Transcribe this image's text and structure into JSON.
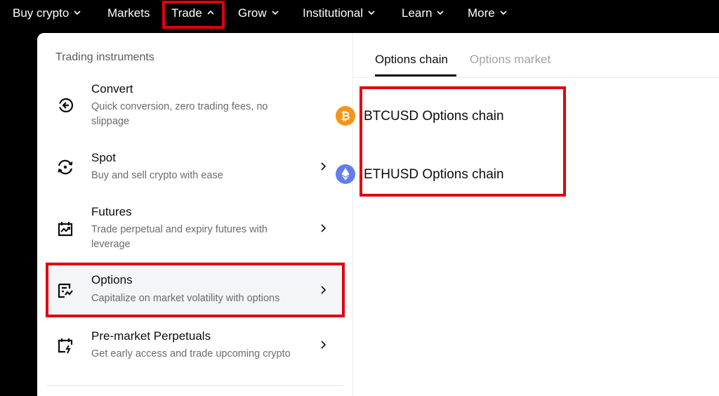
{
  "nav": {
    "items": [
      {
        "label": "Buy crypto"
      },
      {
        "label": "Markets"
      },
      {
        "label": "Trade"
      },
      {
        "label": "Grow"
      },
      {
        "label": "Institutional"
      },
      {
        "label": "Learn"
      },
      {
        "label": "More"
      }
    ],
    "active": "Trade"
  },
  "menu": {
    "section_title": "Trading instruments",
    "items": [
      {
        "title": "Convert",
        "desc": "Quick conversion, zero trading fees, no slippage",
        "icon": "convert-icon"
      },
      {
        "title": "Spot",
        "desc": "Buy and sell crypto with ease",
        "icon": "spot-icon"
      },
      {
        "title": "Futures",
        "desc": "Trade perpetual and expiry futures with leverage",
        "icon": "futures-icon"
      },
      {
        "title": "Options",
        "desc": "Capitalize on market volatility with options",
        "icon": "options-icon"
      },
      {
        "title": "Pre-market Perpetuals",
        "desc": "Get early access and trade upcoming crypto",
        "icon": "premarket-icon"
      }
    ]
  },
  "right": {
    "tabs": [
      {
        "label": "Options chain",
        "active": true
      },
      {
        "label": "Options market",
        "active": false
      }
    ],
    "chains": [
      {
        "label": "BTCUSD Options chain",
        "icon": "bitcoin-icon",
        "color": "#f7931a"
      },
      {
        "label": "ETHUSD Options chain",
        "icon": "ethereum-icon",
        "color": "#627eea"
      }
    ]
  },
  "colors": {
    "highlight_box": "#e0000f",
    "nav_bg": "#000000",
    "panel_bg": "#ffffff"
  }
}
